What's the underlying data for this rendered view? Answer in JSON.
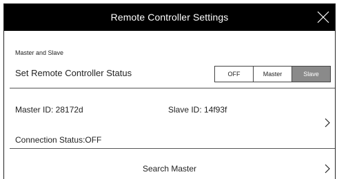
{
  "dialog": {
    "title": "Remote Controller Settings"
  },
  "section": {
    "label": "Master and Slave",
    "status_label": "Set Remote Controller Status",
    "status_options": [
      "OFF",
      "Master",
      "Slave"
    ],
    "selected_option": "Slave"
  },
  "info": {
    "master_id": "Master ID: 28172d",
    "slave_id": "Slave ID: 14f93f",
    "connection_status": "Connection Status:OFF"
  },
  "search": {
    "label": "Search Master"
  },
  "colors": {
    "titlebar": "#000000",
    "selected_segment": "#8a8a8a"
  }
}
